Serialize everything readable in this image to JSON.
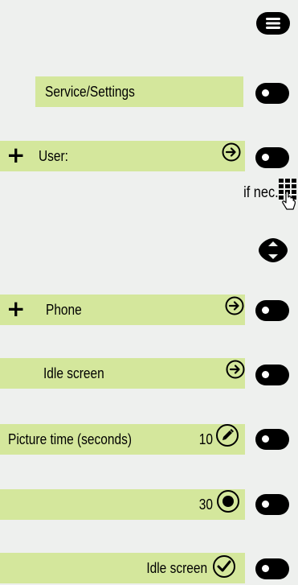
{
  "rows": {
    "service": {
      "label": "Service/Settings"
    },
    "user": {
      "label": "User:",
      "plus": "+"
    },
    "if_nec": {
      "label": "if nec."
    },
    "phone": {
      "label": "Phone",
      "plus": "+"
    },
    "idle_screen": {
      "label": "Idle screen"
    },
    "picture_time": {
      "label": "Picture time (seconds)",
      "value": "10"
    },
    "option_30": {
      "value": "30"
    },
    "idle_screen_confirm": {
      "label": "Idle screen"
    }
  },
  "icons": {
    "menu": "menu-key-icon",
    "softkey": "softkey-icon",
    "arrow": "arrow-right-circle-icon",
    "keypad": "keypad-icon",
    "navigation": "navigation-key-icon",
    "edit": "pencil-circle-icon",
    "radio": "radio-selected-icon",
    "check": "check-circle-icon"
  },
  "colors": {
    "bar": "#d4e79c",
    "background": "#eef0ee",
    "key": "#000000"
  }
}
